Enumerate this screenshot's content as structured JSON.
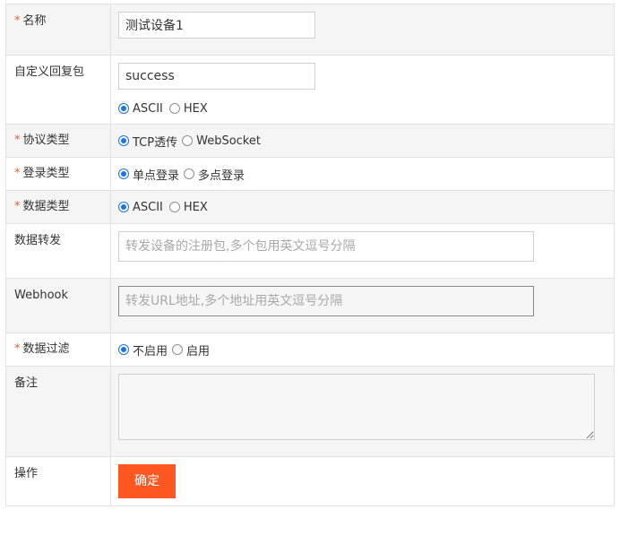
{
  "fields": {
    "name": {
      "required_mark": "*",
      "label": "名称",
      "value": "测试设备1"
    },
    "custom_reply": {
      "label": "自定义回复包",
      "value": "success",
      "options": [
        "ASCII",
        "HEX"
      ],
      "selected": "ASCII"
    },
    "protocol": {
      "required_mark": "*",
      "label": "协议类型",
      "options": [
        "TCP透传",
        "WebSocket"
      ],
      "selected": "TCP透传"
    },
    "login": {
      "required_mark": "*",
      "label": "登录类型",
      "options": [
        "单点登录",
        "多点登录"
      ],
      "selected": "单点登录"
    },
    "data_type": {
      "required_mark": "*",
      "label": "数据类型",
      "options": [
        "ASCII",
        "HEX"
      ],
      "selected": "ASCII"
    },
    "forward": {
      "label": "数据转发",
      "placeholder": "转发设备的注册包,多个包用英文逗号分隔",
      "value": ""
    },
    "webhook": {
      "label": "Webhook",
      "placeholder": "转发URL地址,多个地址用英文逗号分隔",
      "value": ""
    },
    "filter": {
      "required_mark": "*",
      "label": "数据过滤",
      "options": [
        "不启用",
        "启用"
      ],
      "selected": "不启用"
    },
    "memo": {
      "label": "备注",
      "value": ""
    },
    "action": {
      "label": "操作",
      "submit_label": "确定"
    }
  },
  "colors": {
    "accent": "#ff5722",
    "radio": "#1a73e8",
    "row_alt": "#f5f5f5"
  }
}
